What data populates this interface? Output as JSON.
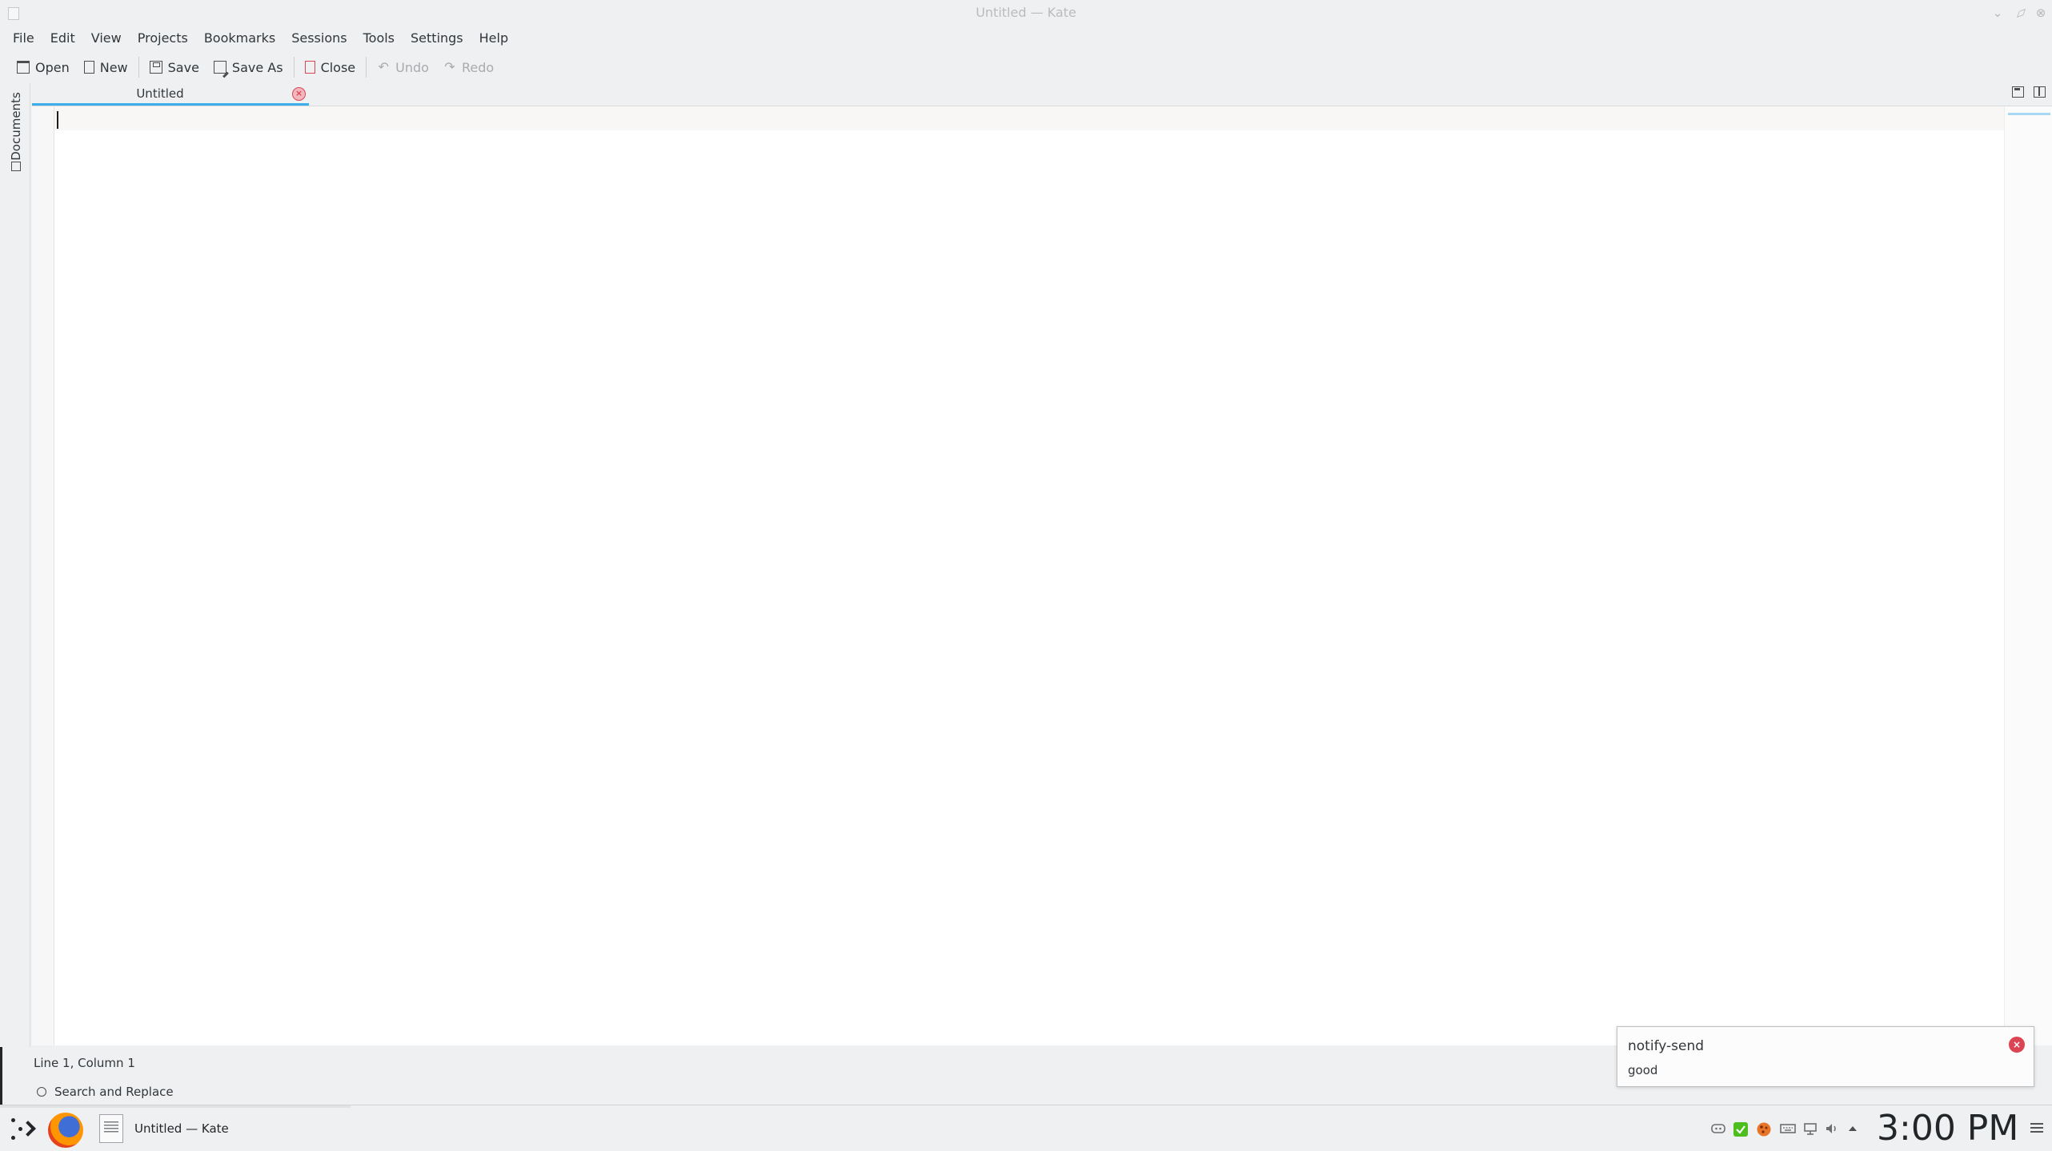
{
  "window": {
    "title": "Untitled — Kate"
  },
  "menubar": {
    "items": [
      "File",
      "Edit",
      "View",
      "Projects",
      "Bookmarks",
      "Sessions",
      "Tools",
      "Settings",
      "Help"
    ]
  },
  "toolbar": {
    "open": "Open",
    "new": "New",
    "save": "Save",
    "save_as": "Save As",
    "close": "Close",
    "undo": "Undo",
    "redo": "Redo"
  },
  "sidebar": {
    "documents_label": "Documents"
  },
  "tabs": [
    {
      "label": "Untitled",
      "active": true
    }
  ],
  "statusbar": {
    "cursor_position": "Line 1, Column 1",
    "search_label": "Search and Replace"
  },
  "notification": {
    "title": "notify-send",
    "body": "good"
  },
  "taskbar": {
    "task_label": "Untitled  — Kate",
    "clock": "3:00 PM"
  },
  "colors": {
    "accent": "#3daee9",
    "close_red": "#da4453",
    "window_bg": "#eff0f1",
    "editor_bg": "#ffffff"
  },
  "icons": {
    "toolbar": [
      "open-icon",
      "new-icon",
      "save-icon",
      "save-as-icon",
      "close-icon",
      "undo-icon",
      "redo-icon"
    ],
    "tray": [
      "discord-icon",
      "checkmark-icon",
      "cookie-icon",
      "keyboard-icon",
      "network-icon",
      "volume-icon",
      "tray-expand-icon"
    ]
  }
}
